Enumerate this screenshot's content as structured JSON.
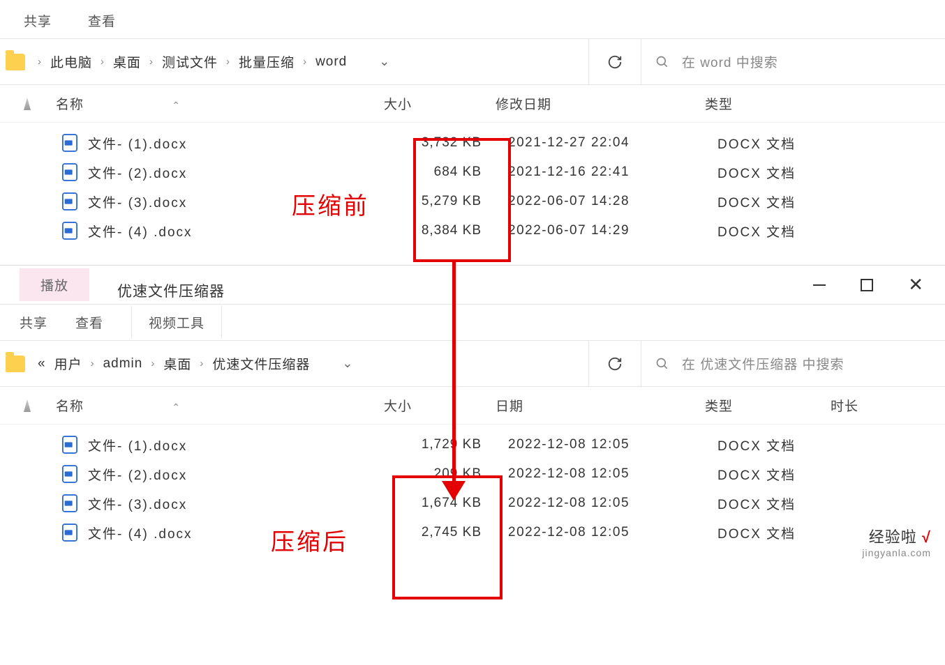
{
  "window_top": {
    "tabs": [
      "共享",
      "查看"
    ],
    "breadcrumb": [
      "此电脑",
      "桌面",
      "测试文件",
      "批量压缩",
      "word"
    ],
    "search_placeholder": "在 word 中搜索",
    "columns": {
      "name": "名称",
      "size": "大小",
      "date": "修改日期",
      "type": "类型"
    },
    "files": [
      {
        "name": "文件- (1).docx",
        "size": "3,732 KB",
        "date": "2021-12-27 22:04",
        "type": "DOCX 文档"
      },
      {
        "name": "文件- (2).docx",
        "size": "684 KB",
        "date": "2021-12-16 22:41",
        "type": "DOCX 文档"
      },
      {
        "name": "文件- (3).docx",
        "size": "5,279 KB",
        "date": "2022-06-07 14:28",
        "type": "DOCX 文档"
      },
      {
        "name": "文件- (4) .docx",
        "size": "8,384 KB",
        "date": "2022-06-07 14:29",
        "type": "DOCX 文档"
      }
    ]
  },
  "window_bottom": {
    "title": "优速文件压缩器",
    "play_tab": "播放",
    "video_tools": "视频工具",
    "tabs": [
      "共享",
      "查看"
    ],
    "breadcrumb_prefix": "«",
    "breadcrumb": [
      "用户",
      "admin",
      "桌面",
      "优速文件压缩器"
    ],
    "search_placeholder": "在 优速文件压缩器 中搜索",
    "columns": {
      "name": "名称",
      "size": "大小",
      "date": "日期",
      "type": "类型",
      "duration": "时长"
    },
    "files": [
      {
        "name": "文件- (1).docx",
        "size": "1,729 KB",
        "date": "2022-12-08 12:05",
        "type": "DOCX 文档"
      },
      {
        "name": "文件- (2).docx",
        "size": "209 KB",
        "date": "2022-12-08 12:05",
        "type": "DOCX 文档"
      },
      {
        "name": "文件- (3).docx",
        "size": "1,674 KB",
        "date": "2022-12-08 12:05",
        "type": "DOCX 文档"
      },
      {
        "name": "文件- (4) .docx",
        "size": "2,745 KB",
        "date": "2022-12-08 12:05",
        "type": "DOCX 文档"
      }
    ]
  },
  "annotations": {
    "before": "压缩前",
    "after": "压缩后"
  },
  "watermark": {
    "line1a": "经验啦",
    "line1b": "√",
    "line2": "jingyanla.com"
  }
}
